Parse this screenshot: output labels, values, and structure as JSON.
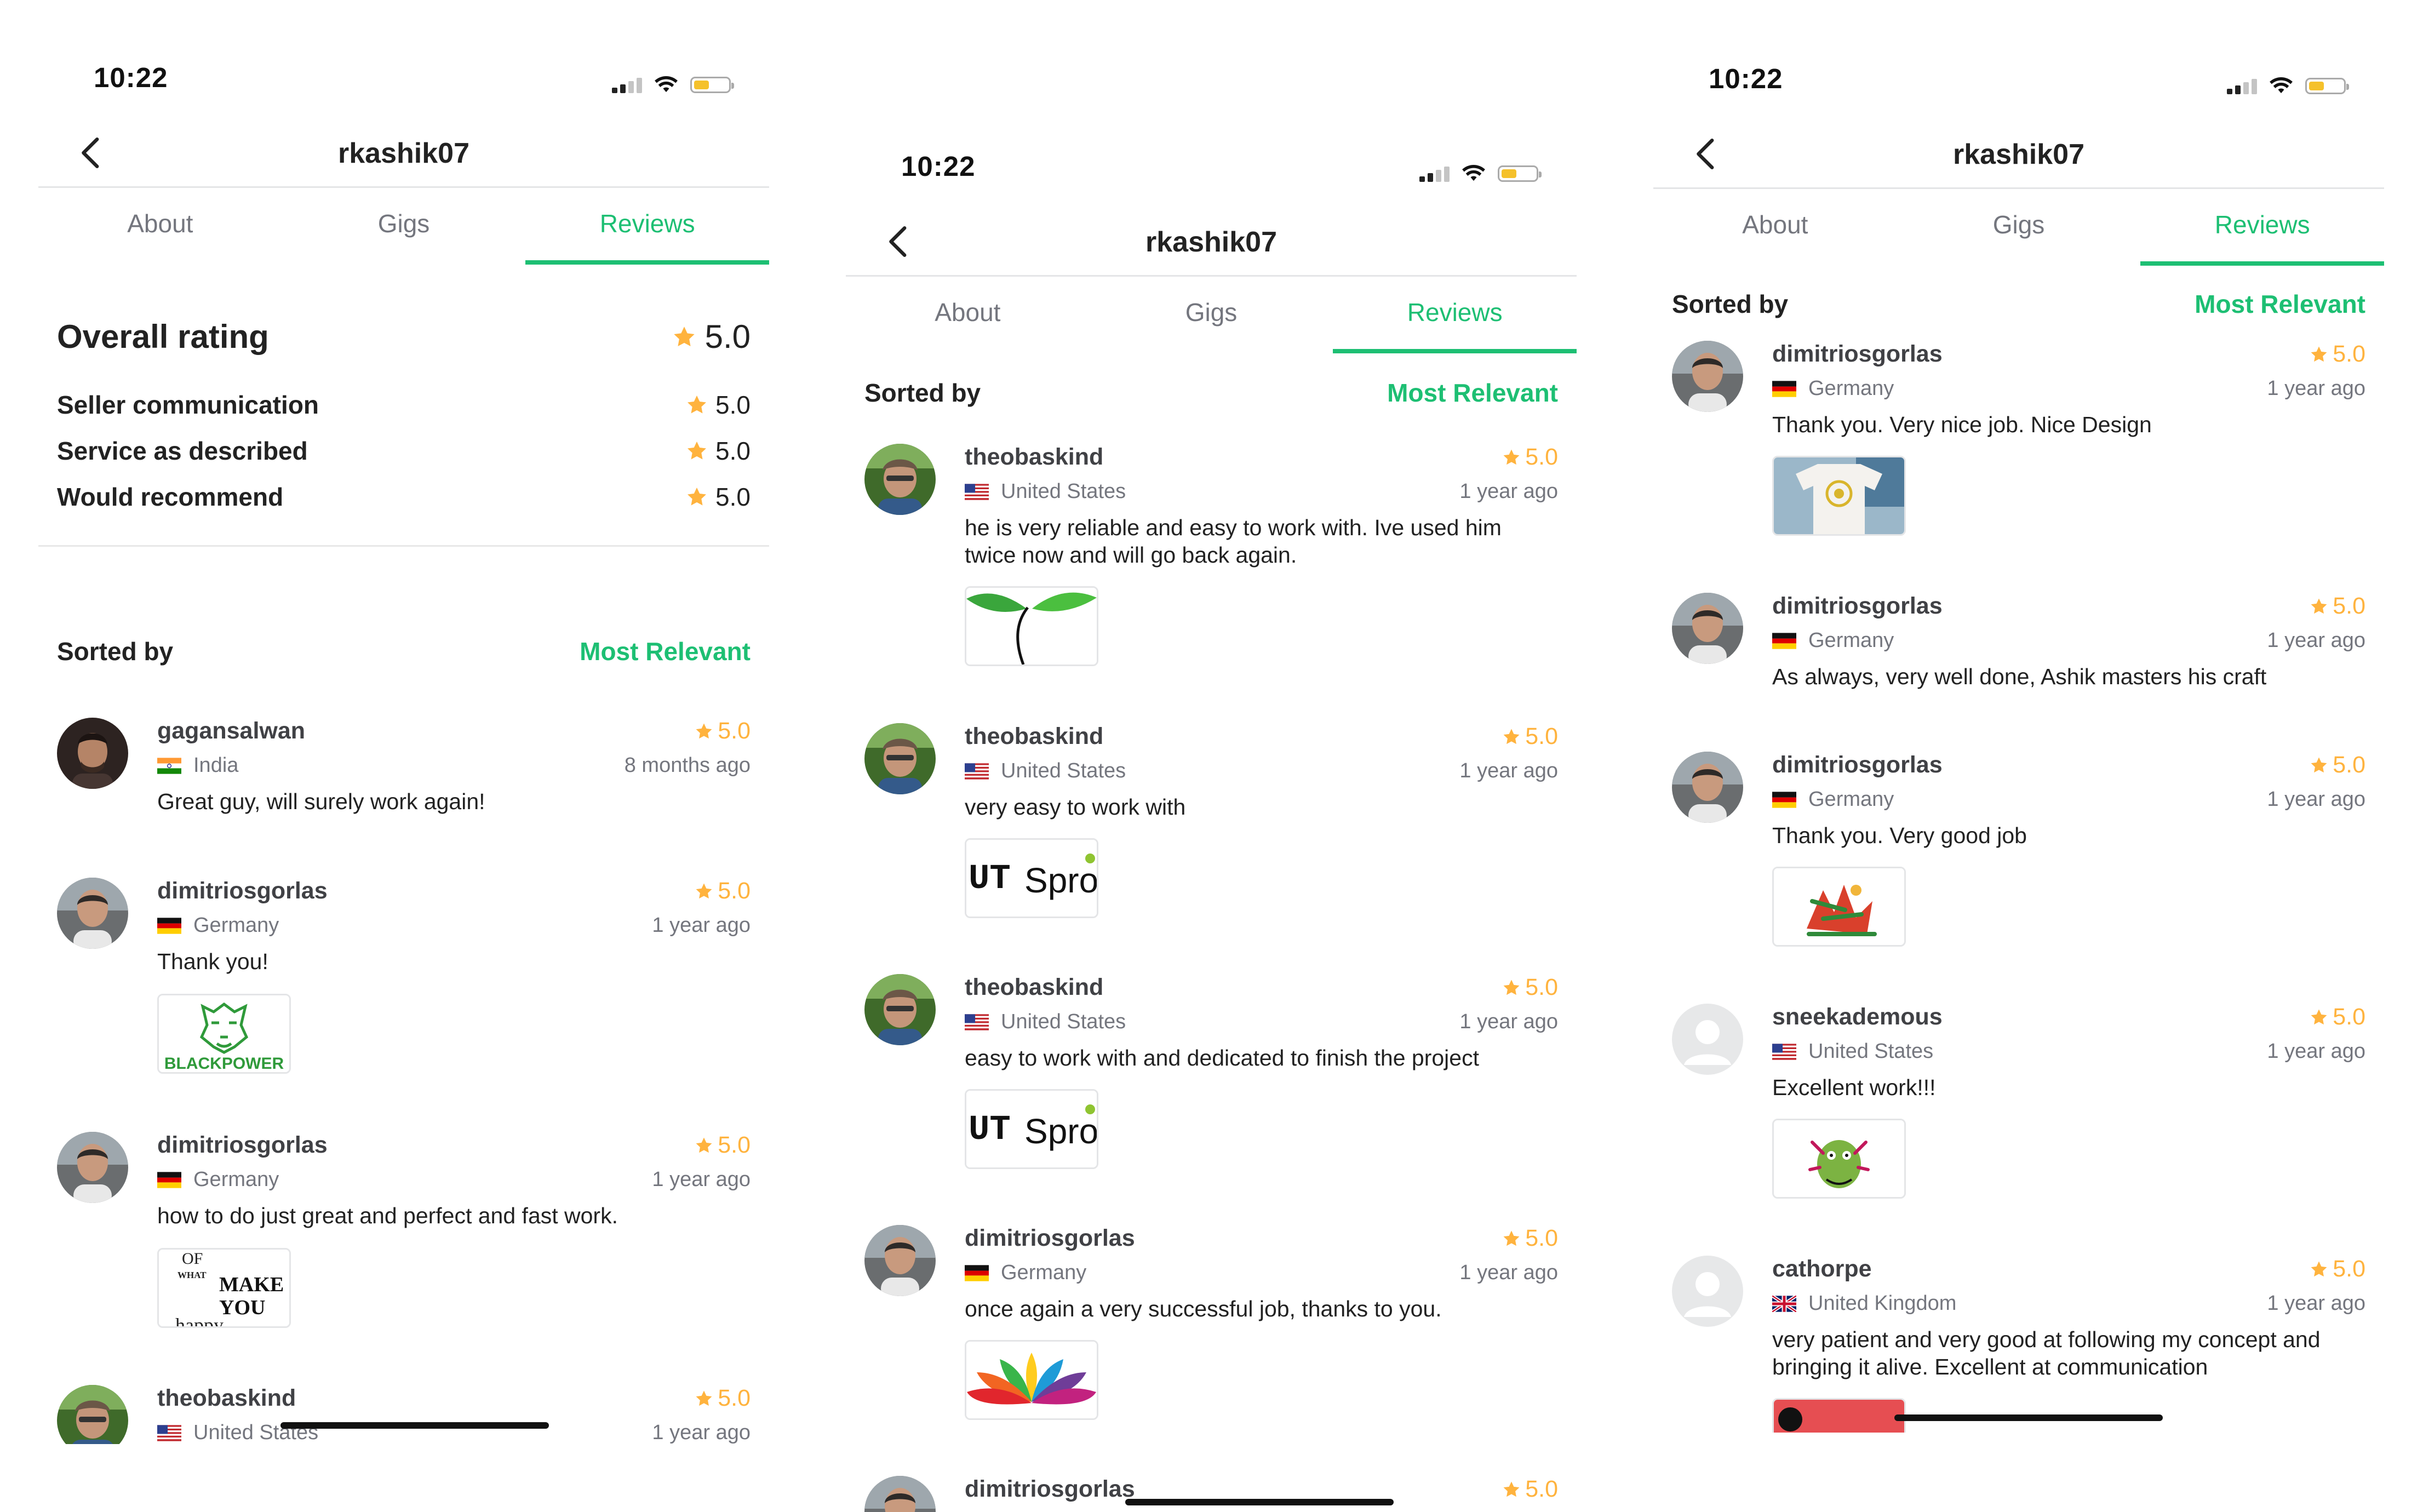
{
  "screens": [
    {
      "status": {
        "time": "10:22"
      },
      "header": {
        "title": "rkashik07"
      },
      "tabs": [
        "About",
        "Gigs",
        "Reviews"
      ],
      "overall": {
        "title": "Overall rating",
        "value": "5.0",
        "rows": [
          {
            "label": "Seller communication",
            "value": "5.0"
          },
          {
            "label": "Service as described",
            "value": "5.0"
          },
          {
            "label": "Would recommend",
            "value": "5.0"
          }
        ]
      },
      "sort": {
        "label": "Sorted by",
        "value": "Most Relevant"
      },
      "reviews": [
        {
          "name": "gagansalwan",
          "rating": "5.0",
          "country": "India",
          "time": "8 months ago",
          "text": "Great guy, will surely work again!"
        },
        {
          "name": "dimitriosgorlas",
          "rating": "5.0",
          "country": "Germany",
          "time": "1 year ago",
          "text": "Thank you!",
          "thumb_text": "BLACKPOWER"
        },
        {
          "name": "dimitriosgorlas",
          "rating": "5.0",
          "country": "Germany",
          "time": "1 year ago",
          "text": "how to do just great and perfect and fast work.",
          "thumb_text": [
            "OF",
            "WHAT",
            "MAKE",
            "YOU",
            "happy"
          ]
        },
        {
          "name": "theobaskind",
          "rating": "5.0",
          "country": "United States",
          "time": "1 year ago",
          "text": ""
        }
      ]
    },
    {
      "status": {
        "time": "10:22"
      },
      "header": {
        "title": "rkashik07"
      },
      "tabs": [
        "About",
        "Gigs",
        "Reviews"
      ],
      "sort": {
        "label": "Sorted by",
        "value": "Most Relevant"
      },
      "reviews": [
        {
          "name": "theobaskind",
          "rating": "5.0",
          "country": "United States",
          "time": "1 year ago",
          "text": "he is very reliable and easy to work with. Ive used him twice now and will go back again."
        },
        {
          "name": "theobaskind",
          "rating": "5.0",
          "country": "United States",
          "time": "1 year ago",
          "text": "very easy to work with",
          "thumb_text": [
            "UT",
            "Spro"
          ]
        },
        {
          "name": "theobaskind",
          "rating": "5.0",
          "country": "United States",
          "time": "1 year ago",
          "text": "easy to work with and dedicated to finish the project",
          "thumb_text": [
            "UT",
            "Spro"
          ]
        },
        {
          "name": "dimitriosgorlas",
          "rating": "5.0",
          "country": "Germany",
          "time": "1 year ago",
          "text": "once again a very successful job, thanks to you."
        },
        {
          "name": "dimitriosgorlas",
          "rating": "5.0",
          "country": "",
          "time": "",
          "text": ""
        }
      ]
    },
    {
      "status": {
        "time": "10:22"
      },
      "header": {
        "title": "rkashik07"
      },
      "tabs": [
        "About",
        "Gigs",
        "Reviews"
      ],
      "sort": {
        "label": "Sorted by",
        "value": "Most Relevant"
      },
      "reviews": [
        {
          "name": "dimitriosgorlas",
          "rating": "5.0",
          "country": "Germany",
          "time": "1 year ago",
          "text": "Thank you. Very nice job. Nice Design"
        },
        {
          "name": "dimitriosgorlas",
          "rating": "5.0",
          "country": "Germany",
          "time": "1 year ago",
          "text": "As always, very well done, Ashik masters his craft"
        },
        {
          "name": "dimitriosgorlas",
          "rating": "5.0",
          "country": "Germany",
          "time": "1 year ago",
          "text": "Thank you. Very good job"
        },
        {
          "name": "sneekademous",
          "rating": "5.0",
          "country": "United States",
          "time": "1 year ago",
          "text": "Excellent work!!!"
        },
        {
          "name": "cathorpe",
          "rating": "5.0",
          "country": "United Kingdom",
          "time": "1 year ago",
          "text": "very patient and very good at following my concept and bringing it alive.  Excellent at communication"
        }
      ]
    }
  ],
  "colors": {
    "accent": "#1dbf73",
    "star": "#ffb33e",
    "muted": "#74767e",
    "text": "#222325"
  },
  "icons": [
    "back-chevron-icon",
    "signal-icon",
    "wifi-icon",
    "battery-icon",
    "star-icon",
    "flag-icon",
    "default-avatar-icon"
  ]
}
